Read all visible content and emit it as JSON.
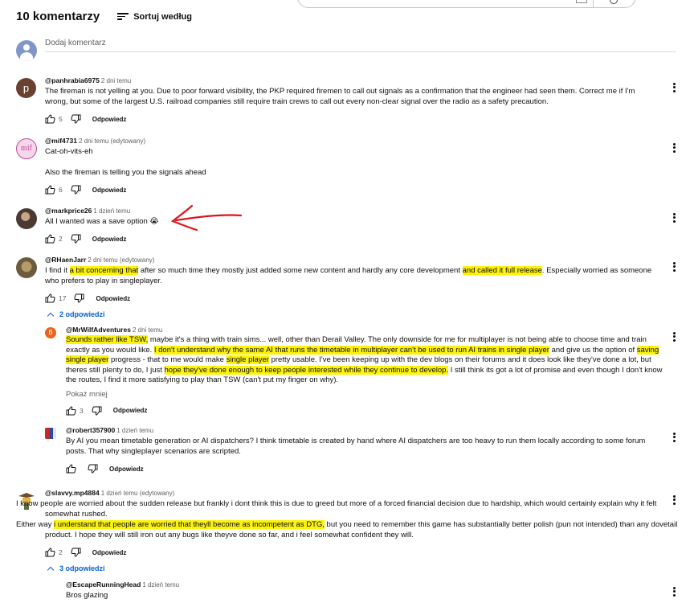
{
  "header": {
    "count": "10 komentarzy",
    "sort_label": "Sortuj według"
  },
  "add_comment": {
    "placeholder": "Dodaj komentarz"
  },
  "colors": {
    "highlight": "#fcf20a",
    "link_blue": "#065fd4",
    "annotation_arrow": "#e0141b"
  },
  "comments": [
    {
      "author": "@panhrabia6975",
      "time": "2 dni temu",
      "avatar_letter": "p",
      "text": "The fireman is not yelling at you. Due to poor forward visibility, the PKP required firemen to call out signals as a confirmation that the engineer had seen them. Correct me if I'm wrong, but some of the largest U.S. railroad companies still require train crews to call out every non-clear signal over the radio as a safety precaution.",
      "likes": "5",
      "reply_label": "Odpowiedz"
    },
    {
      "author": "@mif4731",
      "time": "2 dni temu (edytowany)",
      "avatar_text": "mif",
      "line1": "Cat-oh-vits-eh",
      "line2": "Also the fireman is telling you the signals ahead",
      "likes": "6",
      "reply_label": "Odpowiedz"
    },
    {
      "author": "@markprice26",
      "time": "1 dzień temu",
      "text": "All I wanted was a save option 😭",
      "likes": "2",
      "reply_label": "Odpowiedz"
    },
    {
      "author": "@RHaenJarr",
      "time": "2 dni temu (edytowany)",
      "t1": "I find it ",
      "h1": "a bit concerning that",
      "t2": " after so much time they mostly just added some new content and hardly any core development ",
      "h2": "and called it full release",
      "t3": ". Especially worried as someone who prefers to play in singleplayer.",
      "likes": "17",
      "reply_label": "Odpowiedz",
      "replies_toggle": "2 odpowiedzi"
    },
    {
      "author": "@MrWilfAdventures",
      "time": "2 dni temu",
      "avatar_letter": "B",
      "h1": "Sounds rather like TSW,",
      "t1": " maybe it's a thing with train sims... well, other than Derail Valley.  The only downside for me for multiplayer is not being able to choose time and train exactly as you would like.  ",
      "h2": "I don't understand why the same AI that runs the timetable in multiplayer can't be used to run AI trains in single player",
      "t2": " and give us the option of ",
      "h3": "saving single player",
      "t3": " progress - that to me would make ",
      "h4": "single player",
      "t4": " pretty usable.  I've been keeping up with the dev blogs on their forums and it does look like they've done a lot, but theres still plenty to do, I just ",
      "h5": "hope they've done enough to keep people interested while they continue to develop.",
      "t5": "  I still think its got a lot of promise and even though I don't know the routes, I find it more satisfying to play than TSW (can't put my finger on why).",
      "show_less": "Pokaż mniej",
      "likes": "3",
      "reply_label": "Odpowiedz"
    },
    {
      "author": "@robert357900",
      "time": "1 dzień temu",
      "text": "By AI you mean timetable generation or AI dispatchers? I think timetable is created by hand where AI dispatchers are too heavy to run them locally according to some forum posts. That why singleplayer scenarios are scripted.",
      "likes": "",
      "reply_label": "Odpowiedz"
    },
    {
      "author": "@slavvy.mp4884",
      "time": "1 dzień temu (edytowany)",
      "p1": "I know people are worried about the sudden release but frankly i dont think this is due to greed but more of a forced financial decision due to hardship, which would certainly explain why it felt somewhat rushed.",
      "t0": "Either way ",
      "h1": "i understand that people are worried that theyll become as incompetent as DTG,",
      "t1": " but you need to remember this game has substantially better polish (pun not intended) than any dovetail product. I hope they will still iron out any bugs like theyve done so far, and i feel somewhat confident they will.",
      "likes": "2",
      "reply_label": "Odpowiedz",
      "replies_toggle": "3 odpowiedzi"
    },
    {
      "author": "@EscapeRunningHead",
      "time": "1 dzień temu",
      "text": "Bros glazing"
    }
  ]
}
